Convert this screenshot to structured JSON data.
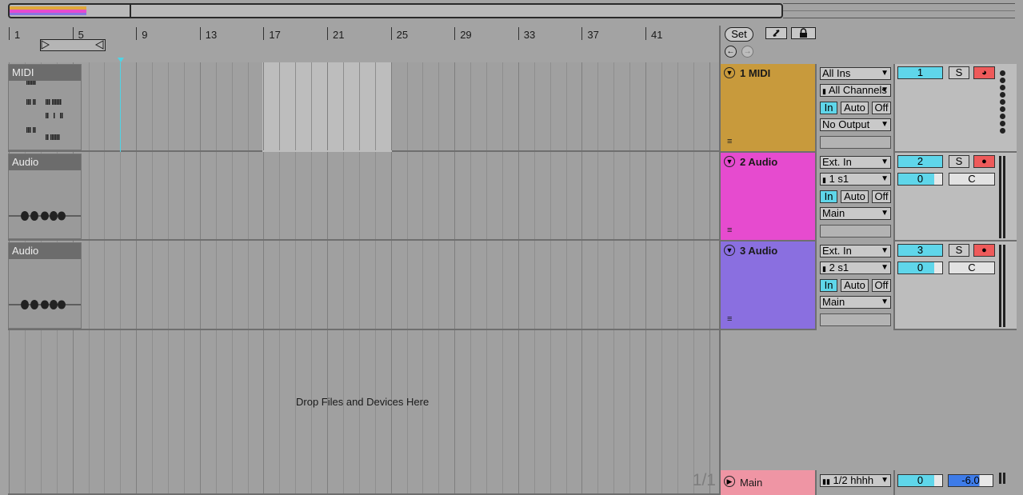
{
  "ruler": {
    "bars": [
      "1",
      "5",
      "9",
      "13",
      "17",
      "21",
      "25",
      "29",
      "33",
      "37",
      "41"
    ]
  },
  "transport": {
    "set_label": "Set",
    "expand_icon": "expand-arrows-icon",
    "lock_icon": "lock-icon",
    "back_icon": "arrow-left-icon",
    "forward_icon": "arrow-right-icon"
  },
  "clips": [
    {
      "title": "MIDI"
    },
    {
      "title": "Audio"
    },
    {
      "title": "Audio"
    }
  ],
  "arrangement": {
    "drop_text": "Drop Files and Devices Here",
    "page_counter": "1/1"
  },
  "tracks": [
    {
      "name": "1 MIDI",
      "color": "#c89a3c",
      "input_type": "All Ins",
      "input_channel": "All Channels",
      "monitor": [
        "In",
        "Auto",
        "Off"
      ],
      "output": "No Output",
      "number": "1",
      "solo": "S"
    },
    {
      "name": "2 Audio",
      "color": "#e64bcf",
      "input_type": "Ext. In",
      "input_channel": "1 s1",
      "monitor": [
        "In",
        "Auto",
        "Off"
      ],
      "output": "Main",
      "number": "2",
      "solo": "S",
      "volume": "0",
      "pan": "C"
    },
    {
      "name": "3 Audio",
      "color": "#8a6fe0",
      "input_type": "Ext. In",
      "input_channel": "2 s1",
      "monitor": [
        "In",
        "Auto",
        "Off"
      ],
      "output": "Main",
      "number": "3",
      "solo": "S",
      "volume": "0",
      "pan": "C"
    }
  ],
  "main_track": {
    "name": "Main",
    "color": "#ef95a4",
    "output": "1/2 hhhh",
    "volume": "0",
    "cue": "-6.0"
  },
  "colors": {
    "accent_cyan": "#5fd6ea",
    "arm_red": "#ee5a5a",
    "cue_blue": "#3d7be8"
  }
}
